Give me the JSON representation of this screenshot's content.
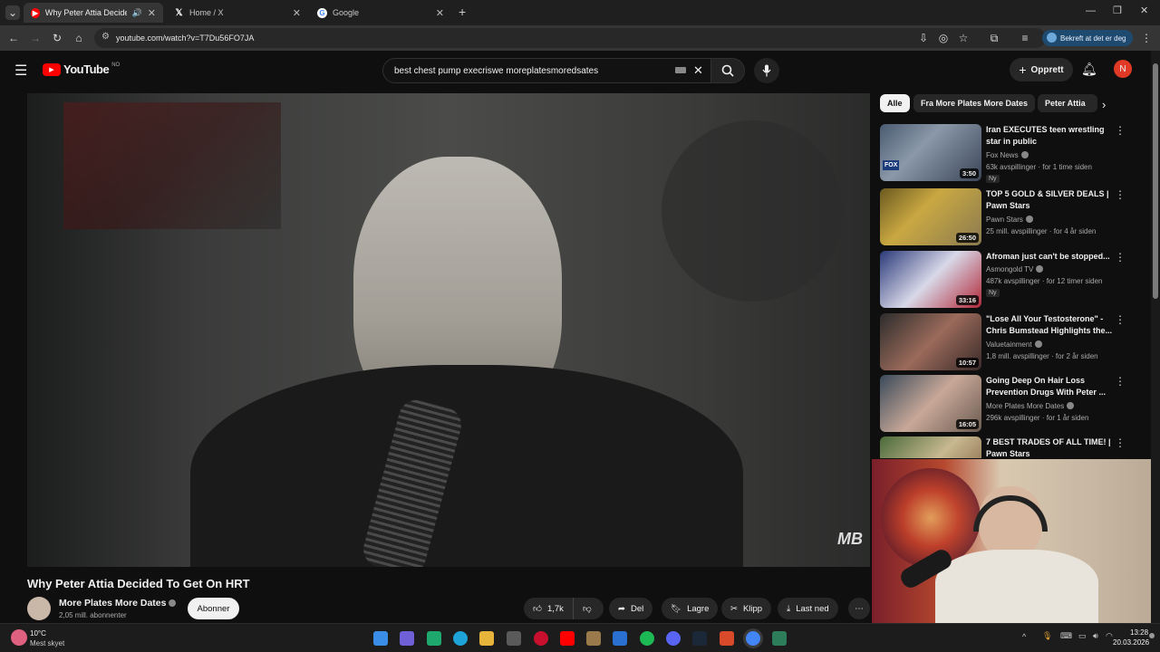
{
  "browser": {
    "tabs": [
      {
        "title": "Why Peter Attia Decided To",
        "active": true
      },
      {
        "title": "Home / X",
        "active": false
      },
      {
        "title": "Google",
        "active": false
      }
    ],
    "new_tab": "+",
    "url": "youtube.com/watch?v=T7Du56FO7JA",
    "profile_chip": "Bekreft at det er deg"
  },
  "youtube": {
    "logo": "YouTube",
    "region": "NO",
    "search_query": "best chest pump execriswe moreplatesmoredsates",
    "create_label": "Opprett",
    "avatar_initial": "N"
  },
  "video": {
    "title": "Why Peter Attia Decided To Get On HRT",
    "watermark": "MB",
    "channel": "More Plates More Dates",
    "subscribers": "2,05 mill. abonnenter",
    "subscribe_label": "Abonner",
    "like_count": "1,7k",
    "share_label": "Del",
    "save_label": "Lagre",
    "clip_label": "Klipp",
    "download_label": "Last ned"
  },
  "chips": [
    "Alle",
    "Fra More Plates More Dates",
    "Peter Attia"
  ],
  "recommendations": [
    {
      "title": "Iran EXECUTES teen wrestling star in public",
      "channel": "Fox News",
      "meta": "63k avspillinger · for 1 time siden",
      "badge": "Ny",
      "duration": "3:50"
    },
    {
      "title": "TOP 5 GOLD & SILVER DEALS | Pawn Stars",
      "channel": "Pawn Stars",
      "meta": "25 mill. avspillinger · for 4 år siden",
      "badge": "",
      "duration": "26:50"
    },
    {
      "title": "Afroman just can't be stopped...",
      "channel": "Asmongold TV",
      "meta": "487k avspillinger · for 12 timer siden",
      "badge": "Ny",
      "duration": "33:16"
    },
    {
      "title": "\"Lose All Your Testosterone\" - Chris Bumstead Highlights the...",
      "channel": "Valuetainment",
      "meta": "1,8 mill. avspillinger · for 2 år siden",
      "badge": "",
      "duration": "10:57"
    },
    {
      "title": "Going Deep On Hair Loss Prevention Drugs With Peter ...",
      "channel": "More Plates More Dates",
      "meta": "296k avspillinger · for 1 år siden",
      "badge": "",
      "duration": "16:05"
    },
    {
      "title": "7 BEST TRADES OF ALL TIME! | Pawn Stars",
      "channel": "",
      "meta": "",
      "badge": "",
      "duration": ""
    }
  ],
  "taskbar": {
    "temperature": "10°C",
    "weather": "Mest skyet",
    "time": "13:28",
    "date": "20.03.2026"
  },
  "colors": {
    "yt_red": "#ff0000",
    "background": "#0f0f0f",
    "chip_bg": "#272727",
    "profile_chip": "#1f4a70"
  }
}
